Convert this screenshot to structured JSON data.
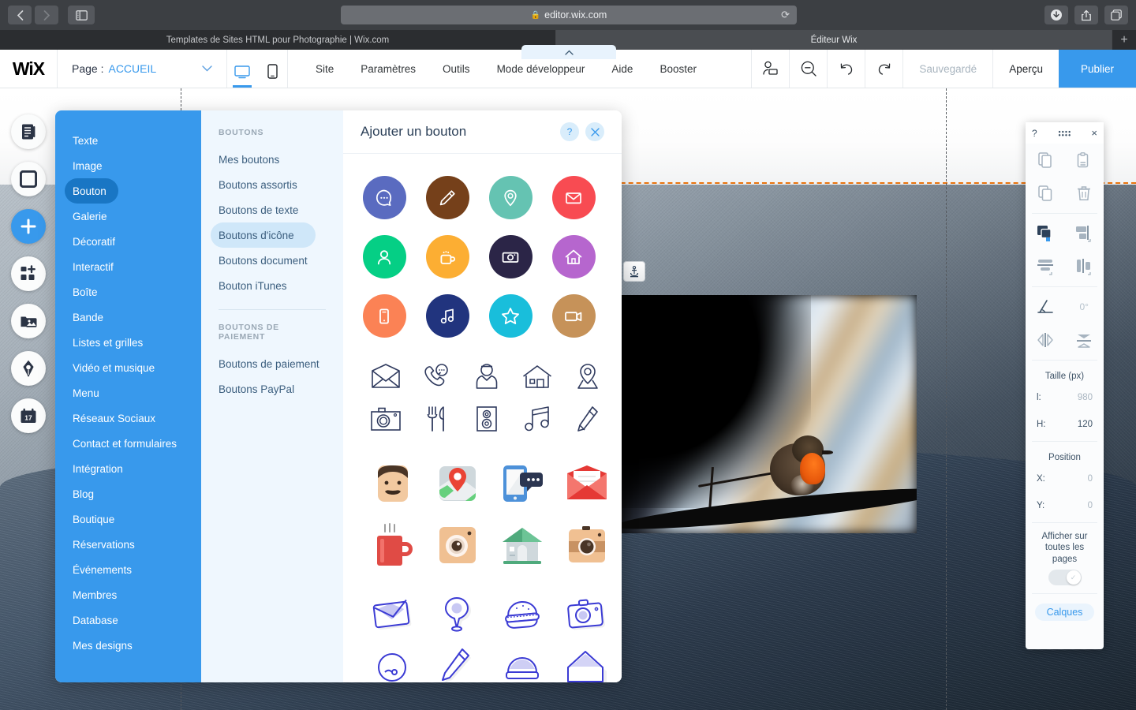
{
  "browser": {
    "back_icon": "chevron-left-icon",
    "forward_icon": "chevron-right-icon",
    "sidebar_icon": "sidebar-toggle-icon",
    "url": "editor.wix.com",
    "lock_icon": "lock-icon",
    "reload_icon": "reload-icon",
    "download_icon": "download-icon",
    "share_icon": "share-icon",
    "tabs_overview_icon": "tabs-overview-icon",
    "tabs": [
      {
        "title": "Templates de Sites HTML pour Photographie | Wix.com",
        "active": false
      },
      {
        "title": "Éditeur Wix",
        "active": true
      }
    ],
    "new_tab_label": "+"
  },
  "topbar": {
    "logo": "WiX",
    "page_label": "Page :",
    "page_value": "ACCUEIL",
    "chevron_icon": "chevron-down-icon",
    "devices": [
      {
        "name": "desktop-view",
        "icon": "monitor-icon",
        "active": true
      },
      {
        "name": "mobile-view",
        "icon": "phone-icon",
        "active": false
      }
    ],
    "menu": [
      "Site",
      "Paramètres",
      "Outils",
      "Mode développeur",
      "Aide",
      "Booster"
    ],
    "dev_pill_icon": "chevron-up-icon",
    "right_icons": [
      {
        "name": "user-roles-icon"
      },
      {
        "name": "zoom-out-icon"
      },
      {
        "name": "undo-icon"
      },
      {
        "name": "redo-icon"
      }
    ],
    "saved_label": "Sauvegardé",
    "preview_label": "Aperçu",
    "publish_label": "Publier"
  },
  "rail": [
    {
      "name": "sidebar-item-pages",
      "icon": "page-icon"
    },
    {
      "name": "sidebar-item-background",
      "icon": "square-icon"
    },
    {
      "name": "sidebar-item-add",
      "icon": "plus-icon",
      "active": true
    },
    {
      "name": "sidebar-item-apps",
      "icon": "apps-add-icon"
    },
    {
      "name": "sidebar-item-media",
      "icon": "media-icon"
    },
    {
      "name": "sidebar-item-blog",
      "icon": "pen-nib-icon"
    },
    {
      "name": "sidebar-item-bookings",
      "icon": "calendar-icon"
    }
  ],
  "add_panel": {
    "categories": [
      {
        "label": "Texte",
        "selected": false
      },
      {
        "label": "Image",
        "selected": false
      },
      {
        "label": "Bouton",
        "selected": true
      },
      {
        "label": "Galerie",
        "selected": false
      },
      {
        "label": "Décoratif",
        "selected": false
      },
      {
        "label": "Interactif",
        "selected": false
      },
      {
        "label": "Boîte",
        "selected": false
      },
      {
        "label": "Bande",
        "selected": false
      },
      {
        "label": "Listes et grilles",
        "selected": false
      },
      {
        "label": "Vidéo et musique",
        "selected": false
      },
      {
        "label": "Menu",
        "selected": false
      },
      {
        "label": "Réseaux Sociaux",
        "selected": false
      },
      {
        "label": "Contact et formulaires",
        "selected": false
      },
      {
        "label": "Intégration",
        "selected": false
      },
      {
        "label": "Blog",
        "selected": false
      },
      {
        "label": "Boutique",
        "selected": false
      },
      {
        "label": "Réservations",
        "selected": false
      },
      {
        "label": "Événements",
        "selected": false
      },
      {
        "label": "Membres",
        "selected": false
      },
      {
        "label": "Database",
        "selected": false
      },
      {
        "label": "Mes designs",
        "selected": false
      }
    ],
    "group1_title": "BOUTONS",
    "group1_items": [
      {
        "label": "Mes boutons",
        "selected": false
      },
      {
        "label": "Boutons assortis",
        "selected": false
      },
      {
        "label": "Boutons de texte",
        "selected": false
      },
      {
        "label": "Boutons d'icône",
        "selected": true
      },
      {
        "label": "Boutons document",
        "selected": false
      },
      {
        "label": "Bouton iTunes",
        "selected": false
      }
    ],
    "group2_title": "BOUTONS DE PAIEMENT",
    "group2_items": [
      {
        "label": "Boutons de paiement",
        "selected": false
      },
      {
        "label": "Boutons PayPal",
        "selected": false
      }
    ],
    "title": "Ajouter un bouton",
    "help_label": "?",
    "close_label": "×",
    "circle_buttons": [
      {
        "name": "chat-bubble-icon",
        "color": "#5a6bc0"
      },
      {
        "name": "pencil-icon",
        "color": "#75401a"
      },
      {
        "name": "location-pin-icon",
        "color": "#65c3b2"
      },
      {
        "name": "envelope-icon",
        "color": "#f84b52"
      },
      {
        "name": "user-icon",
        "color": "#05cf85"
      },
      {
        "name": "coffee-cup-icon",
        "color": "#fcae33"
      },
      {
        "name": "camera-icon",
        "color": "#2b2547"
      },
      {
        "name": "home-icon",
        "color": "#b666ce"
      },
      {
        "name": "mobile-icon",
        "color": "#fb8255"
      },
      {
        "name": "music-note-icon",
        "color": "#21347e"
      },
      {
        "name": "star-icon",
        "color": "#19bedb"
      },
      {
        "name": "video-camera-icon",
        "color": "#c69259"
      }
    ],
    "outline_buttons_1": [
      {
        "name": "open-envelope-icon"
      },
      {
        "name": "phone-chat-icon"
      },
      {
        "name": "person-icon"
      },
      {
        "name": "house-icon"
      },
      {
        "name": "map-pin-icon"
      },
      {
        "name": "photo-camera-icon"
      },
      {
        "name": "fork-knife-icon"
      },
      {
        "name": "speaker-icon"
      },
      {
        "name": "music-notes-icon"
      },
      {
        "name": "pencil-outline-icon"
      }
    ],
    "flat_buttons": [
      {
        "name": "moustache-man-icon"
      },
      {
        "name": "map-location-icon"
      },
      {
        "name": "phone-message-icon"
      },
      {
        "name": "red-envelope-icon"
      },
      {
        "name": "coffee-mug-icon"
      },
      {
        "name": "instant-camera-icon"
      },
      {
        "name": "shop-house-icon"
      },
      {
        "name": "vintage-camera-icon"
      }
    ],
    "sketch_buttons": [
      {
        "name": "sketch-envelope-icon"
      },
      {
        "name": "sketch-pin-icon"
      },
      {
        "name": "sketch-burger-icon"
      },
      {
        "name": "sketch-camera-icon"
      },
      {
        "name": "sketch-circle-icon"
      },
      {
        "name": "sketch-pencil-icon"
      },
      {
        "name": "sketch-dome-icon"
      },
      {
        "name": "sketch-roof-icon"
      }
    ]
  },
  "right_panel": {
    "help_label": "?",
    "grip_name": "drag-handle-icon",
    "close_label": "×",
    "tools": [
      {
        "name": "copy-icon"
      },
      {
        "name": "paste-icon"
      },
      {
        "name": "duplicate-icon"
      },
      {
        "name": "delete-icon"
      },
      {
        "name": "arrange-icon"
      },
      {
        "name": "align-right-icon"
      },
      {
        "name": "align-middle-icon"
      },
      {
        "name": "align-center-icon"
      }
    ],
    "rotation_icon": "rotation-icon",
    "rotation_value": "0°",
    "flip_h_icon": "flip-horizontal-icon",
    "flip_v_icon": "flip-vertical-icon",
    "size_title": "Taille (px)",
    "width_label": "l:",
    "width_value": "980",
    "height_label": "H:",
    "height_value": "120",
    "position_title": "Position",
    "x_label": "X:",
    "x_value": "0",
    "y_label": "Y:",
    "y_value": "0",
    "show_all_pages_label": "Afficher sur toutes les pages",
    "toggle_state": "on",
    "layers_label": "Calques"
  },
  "canvas": {
    "anchor_icon": "anchor-icon",
    "photo_name": "bird-on-branch-photo"
  },
  "colors": {
    "accent": "#3899ec",
    "panel_blue": "#3899ec",
    "selected_blue": "#1976c4",
    "mid_bg": "#eff7fe",
    "guide_orange": "#e8730e"
  }
}
